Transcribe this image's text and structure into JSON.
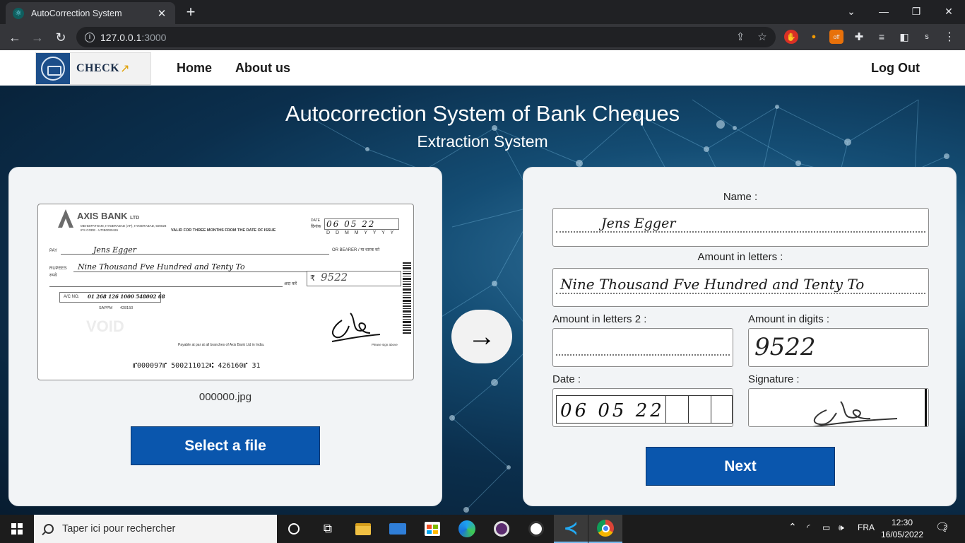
{
  "browser": {
    "tab_title": "AutoCorrection System",
    "tab_close": "✕",
    "new_tab": "+",
    "url_host": "127.0.0.1",
    "url_port": ":3000",
    "profile_initial": "s"
  },
  "nav": {
    "logo_text": "CHECK",
    "home": "Home",
    "about": "About us",
    "logout": "Log Out"
  },
  "page": {
    "title": "Autocorrection System of Bank Cheques",
    "subtitle": "Extraction System"
  },
  "cheque": {
    "bank_name": "AXIS BANK",
    "bank_suffix": "LTD",
    "branch_line1": "MEHDIPATNAM, HYDERABAD (AP), HYDERABAD, 500028",
    "branch_line2": "IFS CODE - UTIB0000426",
    "validity": "VALID FOR THREE MONTHS FROM THE DATE OF ISSUE",
    "date_label": "DATE",
    "date_hindi": "दिनांक",
    "date_value": "06 05 22",
    "date_format": "D D M M Y Y Y Y",
    "pay_label": "PAY",
    "payee": "Jens Egger",
    "bearer": "OR BEARER / या धारक को",
    "rupees_label": "RUPEES",
    "rupees_hindi": "रुपये",
    "amount_words": "Nine Thousand Fve Hundred and Tenty To",
    "ava_kare": "अदा करें",
    "rupee_symbol": "₹",
    "amount_digits": "9522",
    "ac_label": "A/C NO.",
    "ac_number": "01 268 126 1000 548002 68",
    "account_type": "SAPPM",
    "branch_code": "428150",
    "void": "VOID",
    "payable_note": "Payable at par at all branches of Axis Bank Ltd in India.",
    "sign_note": "Please sign above",
    "micr": "⑈000097⑈  500211012⑆ 426160⑈  31"
  },
  "upload": {
    "file_name": "000000.jpg",
    "select_button": "Select a file"
  },
  "extraction": {
    "arrow": "→",
    "name_label": "Name :",
    "name_value": "Jens Egger",
    "amount_letters_label": "Amount in letters :",
    "amount_letters_value": "Nine Thousand Fve Hundred and Tenty To",
    "amount_letters2_label": "Amount in letters 2 :",
    "amount_digits_label": "Amount in digits :",
    "amount_digits_value": "9522",
    "date_label": "Date :",
    "date_value": "06 05 22",
    "signature_label": "Signature :",
    "next_button": "Next"
  },
  "taskbar": {
    "search_placeholder": "Taper ici pour rechercher",
    "language": "FRA",
    "time": "12:30",
    "date": "16/05/2022",
    "notifications": "2"
  }
}
